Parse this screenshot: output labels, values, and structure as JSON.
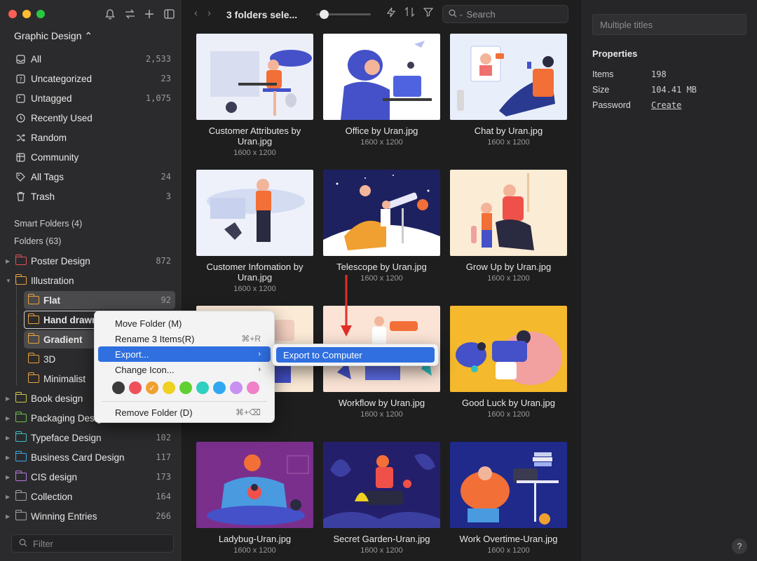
{
  "window": {
    "title": "3 folders sele..."
  },
  "sidebar": {
    "library": "Graphic Design ⌃",
    "nav": [
      {
        "label": "All",
        "count": "2,533",
        "icon": "inbox-icon"
      },
      {
        "label": "Uncategorized",
        "count": "23",
        "icon": "question-box-icon"
      },
      {
        "label": "Untagged",
        "count": "1,075",
        "icon": "tag-box-icon"
      },
      {
        "label": "Recently Used",
        "count": "",
        "icon": "clock-icon"
      },
      {
        "label": "Random",
        "count": "",
        "icon": "shuffle-icon"
      },
      {
        "label": "Community",
        "count": "",
        "icon": "globe-icon"
      },
      {
        "label": "All Tags",
        "count": "24",
        "icon": "tag-icon"
      },
      {
        "label": "Trash",
        "count": "3",
        "icon": "trash-icon"
      }
    ],
    "smart_folders": "Smart Folders (4)",
    "folders_label": "Folders (63)",
    "folders": [
      {
        "label": "Poster Design",
        "count": "872",
        "color": "#e0505a"
      },
      {
        "label": "Illustration",
        "count": "",
        "color": "#e8a23c"
      },
      {
        "label": "Flat",
        "count": "92",
        "color": "#e8a23c"
      },
      {
        "label": "Hand drawn",
        "count": "",
        "color": "#e8a23c"
      },
      {
        "label": "Gradient",
        "count": "",
        "color": "#e8a23c"
      },
      {
        "label": "3D",
        "count": "",
        "color": "#e8a23c"
      },
      {
        "label": "Minimalist",
        "count": "",
        "color": "#e8a23c"
      },
      {
        "label": "Book design",
        "count": "",
        "color": "#c8c84a"
      },
      {
        "label": "Packaging Design",
        "count": "",
        "color": "#6cc04a"
      },
      {
        "label": "Typeface Design",
        "count": "102",
        "color": "#3cc0c0"
      },
      {
        "label": "Business Card Design",
        "count": "117",
        "color": "#3ca8e8"
      },
      {
        "label": "CIS design",
        "count": "173",
        "color": "#b87ae0"
      },
      {
        "label": "Collection",
        "count": "164",
        "color": "#a0a0a0"
      },
      {
        "label": "Winning Entries",
        "count": "266",
        "color": "#a0a0a0"
      }
    ],
    "filter_placeholder": "Filter"
  },
  "toolbar": {
    "search_placeholder": "Search"
  },
  "items": [
    {
      "name": "Customer Attributes by Uran.jpg",
      "dim": "1600 x 1200"
    },
    {
      "name": "Office by Uran.jpg",
      "dim": "1600 x 1200"
    },
    {
      "name": "Chat by Uran.jpg",
      "dim": "1600 x 1200"
    },
    {
      "name": "Customer Infomation by Uran.jpg",
      "dim": "1600 x 1200"
    },
    {
      "name": "Telescope by Uran.jpg",
      "dim": "1600 x 1200"
    },
    {
      "name": "Grow Up by Uran.jpg",
      "dim": "1600 x 1200"
    },
    {
      "name": "...an.jpg",
      "dim": ""
    },
    {
      "name": "Workflow by Uran.jpg",
      "dim": "1600 x 1200"
    },
    {
      "name": "Good Luck by Uran.jpg",
      "dim": "1600 x 1200"
    },
    {
      "name": "Ladybug-Uran.jpg",
      "dim": "1600 x 1200"
    },
    {
      "name": "Secret Garden-Uran.jpg",
      "dim": "1600 x 1200"
    },
    {
      "name": "Work Overtime-Uran.jpg",
      "dim": "1600 x 1200"
    }
  ],
  "inspector": {
    "title_placeholder": "Multiple titles",
    "properties_heading": "Properties",
    "props": [
      {
        "key": "Items",
        "value": "198"
      },
      {
        "key": "Size",
        "value": "104.41 MB"
      },
      {
        "key": "Password",
        "value": "Create"
      }
    ],
    "help": "?"
  },
  "context_menu": {
    "move": "Move Folder (M)",
    "rename": "Rename 3 Items(R)",
    "rename_shortcut": "⌘+R",
    "export": "Export...",
    "change_icon": "Change Icon...",
    "remove": "Remove Folder (D)",
    "remove_shortcut": "⌘+⌫",
    "colors": [
      "#3a3a3a",
      "#f0505a",
      "#f0a030",
      "#f0d020",
      "#60d030",
      "#30d0c0",
      "#30a8f0",
      "#c890f0",
      "#f080c8"
    ],
    "selected_color_index": 2,
    "submenu_export": "Export to Computer"
  }
}
